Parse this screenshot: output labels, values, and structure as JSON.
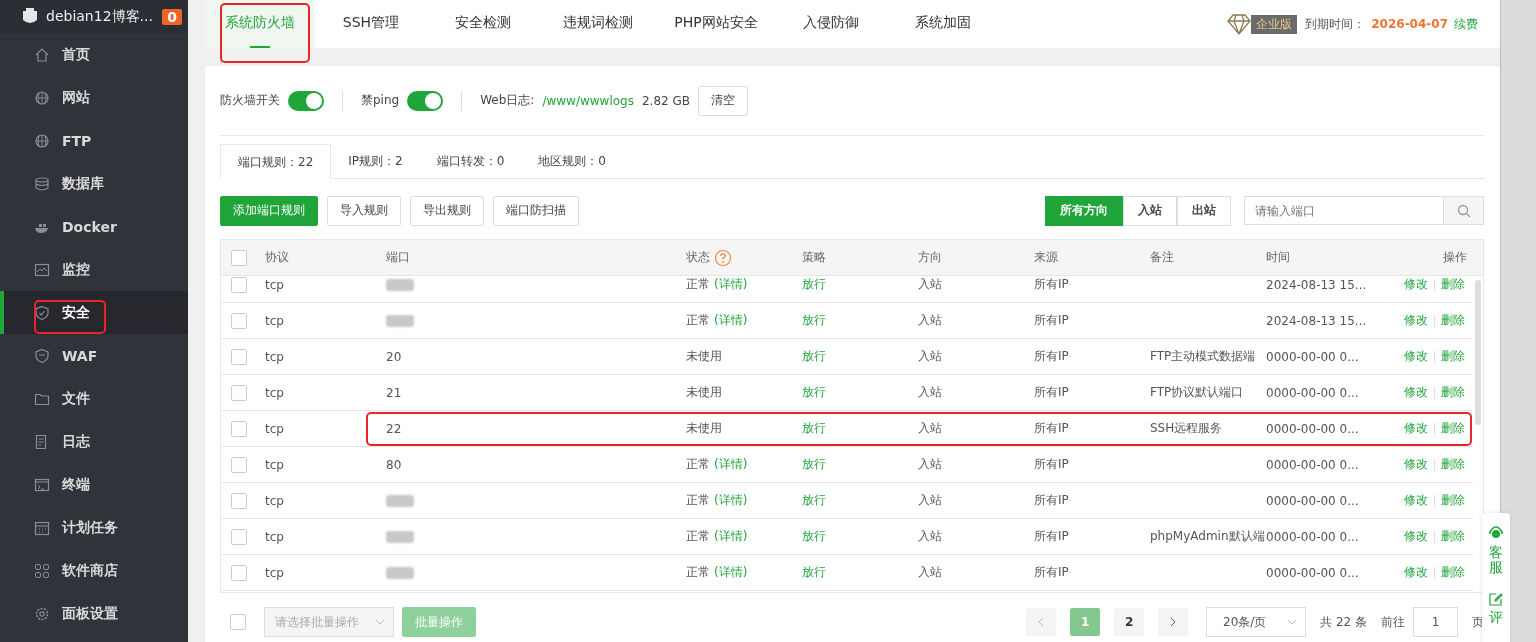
{
  "sidebar": {
    "title": "debian12博客...",
    "badge": "0",
    "items": [
      {
        "label": "首页",
        "selected": false,
        "highlight": false
      },
      {
        "label": "网站",
        "selected": false,
        "highlight": false
      },
      {
        "label": "FTP",
        "selected": false,
        "highlight": false
      },
      {
        "label": "数据库",
        "selected": false,
        "highlight": false
      },
      {
        "label": "Docker",
        "selected": false,
        "highlight": false
      },
      {
        "label": "监控",
        "selected": false,
        "highlight": false
      },
      {
        "label": "安全",
        "selected": true,
        "highlight": true
      },
      {
        "label": "WAF",
        "selected": false,
        "highlight": false
      },
      {
        "label": "文件",
        "selected": false,
        "highlight": false
      },
      {
        "label": "日志",
        "selected": false,
        "highlight": false
      },
      {
        "label": "终端",
        "selected": false,
        "highlight": false
      },
      {
        "label": "计划任务",
        "selected": false,
        "highlight": false
      },
      {
        "label": "软件商店",
        "selected": false,
        "highlight": false
      },
      {
        "label": "面板设置",
        "selected": false,
        "highlight": false
      }
    ]
  },
  "top_tabs": [
    {
      "label": "系统防火墙",
      "selected": true,
      "highlight": true
    },
    {
      "label": "SSH管理",
      "selected": false,
      "highlight": false
    },
    {
      "label": "安全检测",
      "selected": false,
      "highlight": false
    },
    {
      "label": "违规词检测",
      "selected": false,
      "highlight": false
    },
    {
      "label": "PHP网站安全",
      "selected": false,
      "highlight": false
    },
    {
      "label": "入侵防御",
      "selected": false,
      "highlight": false
    },
    {
      "label": "系统加固",
      "selected": false,
      "highlight": false
    }
  ],
  "license": {
    "edition": "企业版",
    "expiry_label": "到期时间：",
    "expiry_date": "2026-04-07",
    "renew": "续费"
  },
  "settings": {
    "firewall_label": "防火墙开关",
    "firewall_on": true,
    "ping_label": "禁ping",
    "ping_on": true,
    "log_label": "Web日志:",
    "log_path": "/www/wwwlogs",
    "log_size": "2.82 GB",
    "clear_button": "清空"
  },
  "rule_tabs": [
    {
      "label": "端口规则：22",
      "selected": true
    },
    {
      "label": "IP规则：2",
      "selected": false
    },
    {
      "label": "端口转发：0",
      "selected": false
    },
    {
      "label": "地区规则：0",
      "selected": false
    }
  ],
  "actions": [
    "添加端口规则",
    "导入规则",
    "导出规则",
    "端口防扫描"
  ],
  "direction_filter": [
    {
      "label": "所有方向",
      "selected": true
    },
    {
      "label": "入站",
      "selected": false
    },
    {
      "label": "出站",
      "selected": false
    }
  ],
  "search": {
    "placeholder": "请输入端口"
  },
  "table": {
    "select_all_checked": false,
    "columns": [
      "协议",
      "端口",
      "状态",
      "策略",
      "方向",
      "来源",
      "备注",
      "时间",
      "操作"
    ],
    "rows": [
      {
        "checked": false,
        "protocol": "tcp",
        "port": "",
        "port_redacted": true,
        "status": "正常",
        "detail": "(详情)",
        "policy": "放行",
        "direction": "入站",
        "source": "所有IP",
        "note": "",
        "time": "2024-08-13 15...",
        "edit": "修改",
        "delete": "删除",
        "highlight": false
      },
      {
        "checked": false,
        "protocol": "tcp",
        "port": "",
        "port_redacted": true,
        "status": "正常",
        "detail": "(详情)",
        "policy": "放行",
        "direction": "入站",
        "source": "所有IP",
        "note": "",
        "time": "2024-08-13 15...",
        "edit": "修改",
        "delete": "删除",
        "highlight": false
      },
      {
        "checked": false,
        "protocol": "tcp",
        "port": "20",
        "port_redacted": false,
        "status": "未使用",
        "policy": "放行",
        "direction": "入站",
        "source": "所有IP",
        "note": "FTP主动模式数据端",
        "time": "0000-00-00 0...",
        "edit": "修改",
        "delete": "删除",
        "highlight": false
      },
      {
        "checked": false,
        "protocol": "tcp",
        "port": "21",
        "port_redacted": false,
        "status": "未使用",
        "policy": "放行",
        "direction": "入站",
        "source": "所有IP",
        "note": "FTP协议默认端口",
        "time": "0000-00-00 0...",
        "edit": "修改",
        "delete": "删除",
        "highlight": false
      },
      {
        "checked": false,
        "protocol": "tcp",
        "port": "22",
        "port_redacted": false,
        "status": "未使用",
        "policy": "放行",
        "direction": "入站",
        "source": "所有IP",
        "note": "SSH远程服务",
        "time": "0000-00-00 0...",
        "edit": "修改",
        "delete": "删除",
        "highlight": true
      },
      {
        "checked": false,
        "protocol": "tcp",
        "port": "80",
        "port_redacted": false,
        "status": "正常",
        "detail": "(详情)",
        "policy": "放行",
        "direction": "入站",
        "source": "所有IP",
        "note": "",
        "time": "0000-00-00 0...",
        "edit": "修改",
        "delete": "删除",
        "highlight": false
      },
      {
        "checked": false,
        "protocol": "tcp",
        "port": "",
        "port_redacted": true,
        "status": "正常",
        "detail": "(详情)",
        "policy": "放行",
        "direction": "入站",
        "source": "所有IP",
        "note": "",
        "time": "0000-00-00 0...",
        "edit": "修改",
        "delete": "删除",
        "highlight": false
      },
      {
        "checked": false,
        "protocol": "tcp",
        "port": "",
        "port_redacted": true,
        "status": "正常",
        "detail": "(详情)",
        "policy": "放行",
        "direction": "入站",
        "source": "所有IP",
        "note": "phpMyAdmin默认端",
        "time": "0000-00-00 0...",
        "edit": "修改",
        "delete": "删除",
        "highlight": false
      },
      {
        "checked": false,
        "protocol": "tcp",
        "port": "",
        "port_redacted": true,
        "status": "正常",
        "detail": "(详情)",
        "policy": "放行",
        "direction": "入站",
        "source": "所有IP",
        "note": "",
        "time": "0000-00-00 0...",
        "edit": "修改",
        "delete": "删除",
        "highlight": false
      }
    ]
  },
  "footer": {
    "select_checked": false,
    "batch_placeholder": "请选择批量操作",
    "batch_button": "批量操作",
    "pages": [
      {
        "label": "1",
        "selected": true
      },
      {
        "label": "2",
        "selected": false
      }
    ],
    "page_size": "20条/页",
    "total": "共 22 条",
    "goto_label": "前往",
    "goto_value": "1",
    "page_unit": "页"
  },
  "float_widget": {
    "service": "客服",
    "review": "评"
  }
}
